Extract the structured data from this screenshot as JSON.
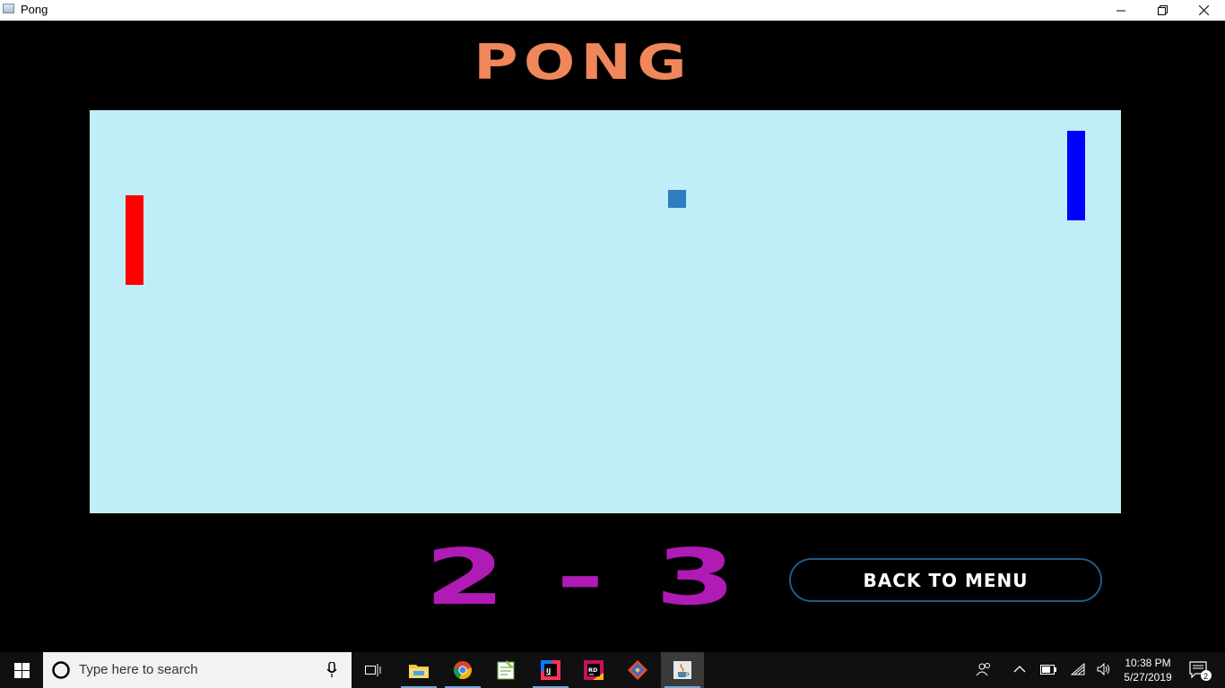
{
  "window": {
    "title": "Pong"
  },
  "game": {
    "title": "PONG",
    "score": {
      "left": "2",
      "separator": "-",
      "right": "3"
    },
    "back_button_label": "BACK TO MENU",
    "colors": {
      "title": "#f0875a",
      "court": "#bfedf8",
      "left_paddle": "#ff0000",
      "right_paddle": "#0000ff",
      "ball": "#2e7dbf",
      "score": "#b01ab5"
    }
  },
  "taskbar": {
    "search_placeholder": "Type here to search",
    "apps": [
      "file-explorer",
      "chrome",
      "notepad-plus",
      "intellij-idea",
      "rider",
      "git-tool",
      "java"
    ],
    "clock": {
      "time": "10:38 PM",
      "date": "5/27/2019"
    },
    "notification_count": "2"
  }
}
